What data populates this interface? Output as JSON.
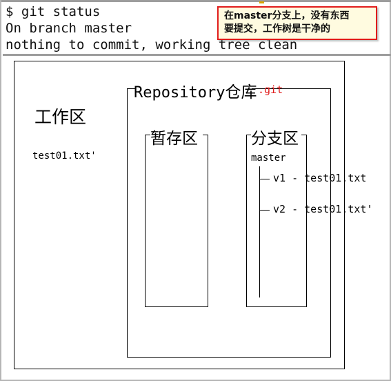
{
  "terminal": {
    "lines": [
      "$ git status",
      "On branch master",
      "nothing to commit, working tree clean"
    ]
  },
  "note": {
    "lines": [
      "在master分支上，没有东西",
      "要提交，工作树是干净的"
    ],
    "border_color": "#e01b1b",
    "background_color": "#fffbe0"
  },
  "diagram": {
    "working_area": {
      "label": "工作区",
      "file": "test01.txt'"
    },
    "repository": {
      "label_en": "Repository",
      "label_cn": "仓库",
      "git_dir": ".git",
      "git_dir_color": "#e01b1b"
    },
    "staging_area": {
      "label": "暂存区",
      "items": []
    },
    "branch_area": {
      "label": "分支区",
      "branch_name": "master",
      "commits": [
        "v1 - test01.txt",
        "v2 - test01.txt'"
      ]
    }
  }
}
